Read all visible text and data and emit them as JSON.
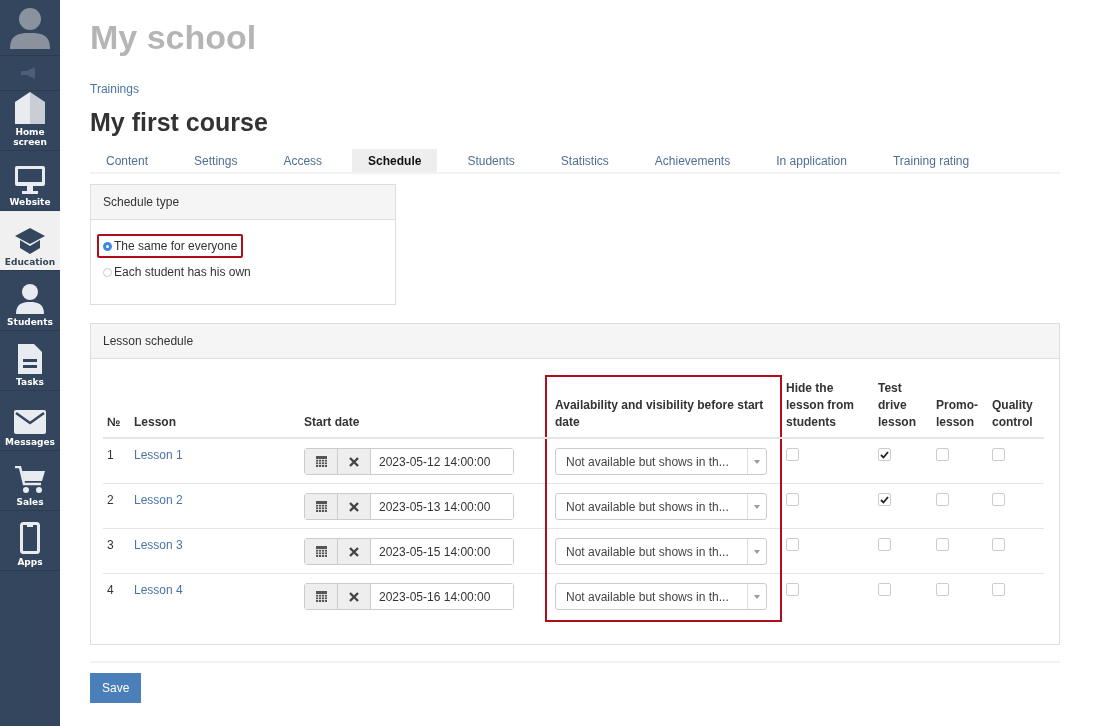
{
  "sidebar": {
    "items": [
      {
        "label": "Home screen",
        "selected": false
      },
      {
        "label": "Website",
        "selected": false
      },
      {
        "label": "Education",
        "selected": true
      },
      {
        "label": "Students",
        "selected": false
      },
      {
        "label": "Tasks",
        "selected": false
      },
      {
        "label": "Messages",
        "selected": false
      },
      {
        "label": "Sales",
        "selected": false
      },
      {
        "label": "Apps",
        "selected": false
      }
    ]
  },
  "school_title": "My school",
  "breadcrumb": "Trainings",
  "course_title": "My first course",
  "tabs": [
    {
      "label": "Content",
      "selected": false
    },
    {
      "label": "Settings",
      "selected": false
    },
    {
      "label": "Access",
      "selected": false
    },
    {
      "label": "Schedule",
      "selected": true
    },
    {
      "label": "Students",
      "selected": false
    },
    {
      "label": "Statistics",
      "selected": false
    },
    {
      "label": "Achievements",
      "selected": false
    },
    {
      "label": "In application",
      "selected": false
    },
    {
      "label": "Training rating",
      "selected": false
    }
  ],
  "schedule_type": {
    "title": "Schedule type",
    "options": [
      {
        "label": "The same for everyone",
        "selected": true,
        "highlighted": true
      },
      {
        "label": "Each student has his own",
        "selected": false,
        "highlighted": false
      }
    ]
  },
  "lesson_schedule": {
    "title": "Lesson schedule",
    "columns": [
      {
        "label": "№",
        "highlighted": false
      },
      {
        "label": "Lesson",
        "highlighted": false
      },
      {
        "label": "Start date",
        "highlighted": false
      },
      {
        "label": "Availability and visibility before start date",
        "highlighted": true
      },
      {
        "label": "Hide the lesson from students",
        "highlighted": false
      },
      {
        "label": "Test drive lesson",
        "highlighted": false
      },
      {
        "label": "Promo-lesson",
        "highlighted": false
      },
      {
        "label": "Quality control",
        "highlighted": false
      }
    ],
    "rows": [
      {
        "number": "1",
        "lesson": "Lesson 1",
        "start_date": "2023-05-12 14:00:00",
        "availability": "Not available but shows in th...",
        "hide": false,
        "test_drive": true,
        "promo": false,
        "quality": false
      },
      {
        "number": "2",
        "lesson": "Lesson 2",
        "start_date": "2023-05-13 14:00:00",
        "availability": "Not available but shows in th...",
        "hide": false,
        "test_drive": true,
        "promo": false,
        "quality": false
      },
      {
        "number": "3",
        "lesson": "Lesson 3",
        "start_date": "2023-05-15 14:00:00",
        "availability": "Not available but shows in th...",
        "hide": false,
        "test_drive": false,
        "promo": false,
        "quality": false
      },
      {
        "number": "4",
        "lesson": "Lesson 4",
        "start_date": "2023-05-16 14:00:00",
        "availability": "Not available but shows in th...",
        "hide": false,
        "test_drive": false,
        "promo": false,
        "quality": false
      }
    ]
  },
  "save_button": "Save"
}
